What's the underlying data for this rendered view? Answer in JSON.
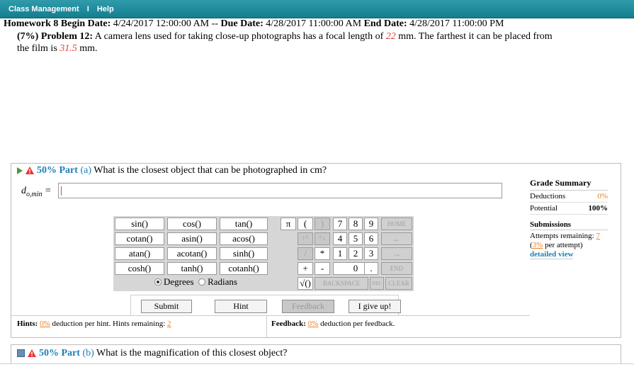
{
  "menu": {
    "class_management": "Class Management",
    "separator": "I",
    "help": "Help"
  },
  "homework": {
    "title": "Homework 8",
    "begin_label": "Begin Date:",
    "begin": "4/24/2017 12:00:00 AM",
    "dash": "--",
    "due_label": "Due Date:",
    "due": "4/28/2017 11:00:00 AM",
    "end_label": "End Date:",
    "end": "4/28/2017 11:00:00 PM"
  },
  "problem": {
    "heading": "(7%) Problem 12:",
    "text1": "A camera lens used for taking close-up photographs has a focal length of",
    "focal": "22",
    "text2": "mm. The farthest it can be placed from the film is",
    "distance": "31.5",
    "text3": "mm."
  },
  "part_a": {
    "percent": "50% Part",
    "letter": "(a)",
    "question": "What is the closest object that can be photographed in cm?",
    "answer_label_main": "d",
    "answer_label_sub": "o,min",
    "answer_equals": "=",
    "answer_value": ""
  },
  "grade_summary": {
    "title": "Grade Summary",
    "deductions_label": "Deductions",
    "deductions": "0%",
    "potential_label": "Potential",
    "potential": "100%",
    "submissions_title": "Submissions",
    "attempts_label": "Attempts remaining:",
    "attempts": "7",
    "per_attempt_pct": "3%",
    "per_attempt_text": "per attempt)",
    "open_paren": "(",
    "detailed_view": "detailed view"
  },
  "calculator": {
    "functions": [
      "sin()",
      "cos()",
      "tan()",
      "cotan()",
      "asin()",
      "acos()",
      "atan()",
      "acotan()",
      "sinh()",
      "cosh()",
      "tanh()",
      "cotanh()"
    ],
    "keys": {
      "pi": "π",
      "lparen": "(",
      "rparen": ")",
      "up": "↑^",
      "hat": "^↓",
      "slash": "/",
      "star": "*",
      "plus": "+",
      "minus": "-",
      "sqrt": "√()",
      "n7": "7",
      "n8": "8",
      "n9": "9",
      "n4": "4",
      "n5": "5",
      "n6": "6",
      "n1": "1",
      "n2": "2",
      "n3": "3",
      "n0": "0",
      "dot": ".",
      "home": "HOME",
      "left": "←",
      "right": "→",
      "end": "END",
      "backspace": "BACKSPACE",
      "del": "DEL",
      "clear": "CLEAR"
    },
    "degrees": "Degrees",
    "radians": "Radians"
  },
  "actions": {
    "submit": "Submit",
    "hint": "Hint",
    "feedback": "Feedback",
    "give_up": "I give up!"
  },
  "hints": {
    "label": "Hints:",
    "pct": "0%",
    "text": "deduction per hint. Hints remaining:",
    "remaining": "2"
  },
  "feedback": {
    "label": "Feedback:",
    "pct": "0%",
    "text": "deduction per feedback."
  },
  "part_b": {
    "percent": "50% Part",
    "letter": "(b)",
    "question": "What is the magnification of this closest object?"
  }
}
